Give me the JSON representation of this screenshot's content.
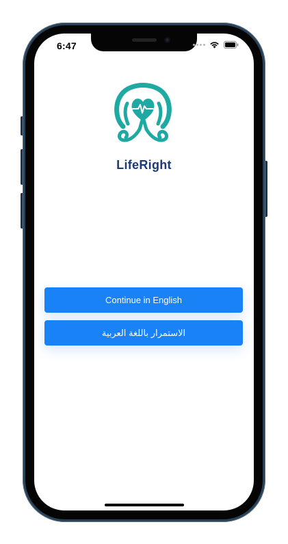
{
  "status_bar": {
    "time": "6:47"
  },
  "brand": {
    "name": "LifeRight",
    "logo_icon": "heart-in-hands-icon",
    "colors": {
      "logo_teal": "#1fa9a3",
      "name_navy": "#1d3a77"
    }
  },
  "language_buttons": {
    "english_label": "Continue in English",
    "arabic_label": "الاستمرار باللغة العربية",
    "color": "#1a82f7"
  }
}
